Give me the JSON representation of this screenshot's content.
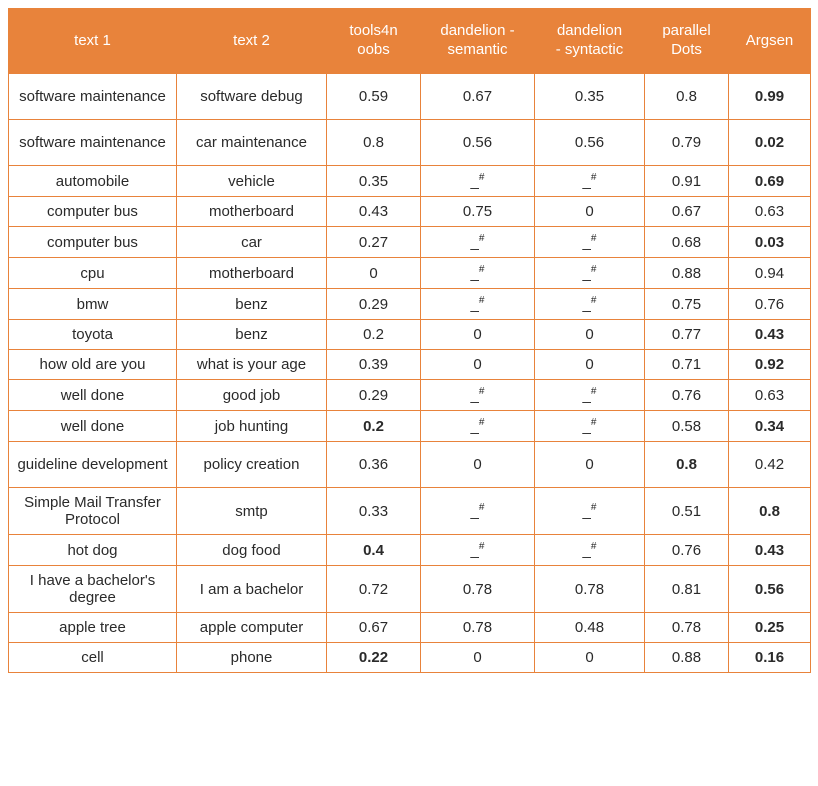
{
  "headers": {
    "text1": "text 1",
    "text2": "text 2",
    "tools4noobs": "tools4n\noobs",
    "dandelion_semantic": "dandelion -\nsemantic",
    "dandelion_syntactic": "dandelion\n- syntactic",
    "parallel_dots": "parallel\nDots",
    "argsen": "Argsen"
  },
  "chart_data": {
    "type": "table",
    "columns": [
      "text 1",
      "text 2",
      "tools4noobs",
      "dandelion - semantic",
      "dandelion - syntactic",
      "parallel Dots",
      "Argsen"
    ],
    "rows": [
      {
        "text1": "software maintenance",
        "text2": "software debug",
        "t4n": "0.59",
        "dsem": "0.67",
        "dsyn": "0.35",
        "pd": "0.8",
        "arg": "0.99",
        "bold": {
          "arg": true
        },
        "tall": true
      },
      {
        "text1": "software maintenance",
        "text2": "car maintenance",
        "t4n": "0.8",
        "dsem": "0.56",
        "dsyn": "0.56",
        "pd": "0.79",
        "arg": "0.02",
        "bold": {
          "arg": true
        },
        "tall": true
      },
      {
        "text1": "automobile",
        "text2": "vehicle",
        "t4n": "0.35",
        "dsem": "_#",
        "dsyn": "_#",
        "pd": "0.91",
        "arg": "0.69",
        "bold": {
          "arg": true
        }
      },
      {
        "text1": "computer bus",
        "text2": "motherboard",
        "t4n": "0.43",
        "dsem": "0.75",
        "dsyn": "0",
        "pd": "0.67",
        "arg": "0.63",
        "bold": {}
      },
      {
        "text1": "computer bus",
        "text2": "car",
        "t4n": "0.27",
        "dsem": "_#",
        "dsyn": "_#",
        "pd": "0.68",
        "arg": "0.03",
        "bold": {
          "arg": true
        }
      },
      {
        "text1": "cpu",
        "text2": "motherboard",
        "t4n": "0",
        "dsem": "_#",
        "dsyn": "_#",
        "pd": "0.88",
        "arg": "0.94",
        "bold": {}
      },
      {
        "text1": "bmw",
        "text2": "benz",
        "t4n": "0.29",
        "dsem": "_#",
        "dsyn": "_#",
        "pd": "0.75",
        "arg": "0.76",
        "bold": {}
      },
      {
        "text1": "toyota",
        "text2": "benz",
        "t4n": "0.2",
        "dsem": "0",
        "dsyn": "0",
        "pd": "0.77",
        "arg": "0.43",
        "bold": {
          "arg": true
        }
      },
      {
        "text1": "how old are you",
        "text2": "what is your age",
        "t4n": "0.39",
        "dsem": "0",
        "dsyn": "0",
        "pd": "0.71",
        "arg": "0.92",
        "bold": {
          "arg": true
        }
      },
      {
        "text1": "well done",
        "text2": "good job",
        "t4n": "0.29",
        "dsem": "_#",
        "dsyn": "_#",
        "pd": "0.76",
        "arg": "0.63",
        "bold": {}
      },
      {
        "text1": "well done",
        "text2": "job hunting",
        "t4n": "0.2",
        "dsem": "_#",
        "dsyn": "_#",
        "pd": "0.58",
        "arg": "0.34",
        "bold": {
          "t4n": true,
          "arg": true
        }
      },
      {
        "text1": "guideline development",
        "text2": "policy creation",
        "t4n": "0.36",
        "dsem": "0",
        "dsyn": "0",
        "pd": "0.8",
        "arg": "0.42",
        "bold": {
          "pd": true
        },
        "tall": true
      },
      {
        "text1": "Simple Mail Transfer Protocol",
        "text2": "smtp",
        "t4n": "0.33",
        "dsem": "_#",
        "dsyn": "_#",
        "pd": "0.51",
        "arg": "0.8",
        "bold": {
          "arg": true
        },
        "tall": true
      },
      {
        "text1": "hot dog",
        "text2": "dog food",
        "t4n": "0.4",
        "dsem": "_#",
        "dsyn": "_#",
        "pd": "0.76",
        "arg": "0.43",
        "bold": {
          "t4n": true,
          "arg": true
        }
      },
      {
        "text1": "I have a bachelor's degree",
        "text2": "I am a bachelor",
        "t4n": "0.72",
        "dsem": "0.78",
        "dsyn": "0.78",
        "pd": "0.81",
        "arg": "0.56",
        "bold": {
          "arg": true
        },
        "tall": true
      },
      {
        "text1": "apple tree",
        "text2": "apple computer",
        "t4n": "0.67",
        "dsem": "0.78",
        "dsyn": "0.48",
        "pd": "0.78",
        "arg": "0.25",
        "bold": {
          "arg": true
        }
      },
      {
        "text1": "cell",
        "text2": "phone",
        "t4n": "0.22",
        "dsem": "0",
        "dsyn": "0",
        "pd": "0.88",
        "arg": "0.16",
        "bold": {
          "t4n": true,
          "arg": true
        }
      }
    ]
  }
}
